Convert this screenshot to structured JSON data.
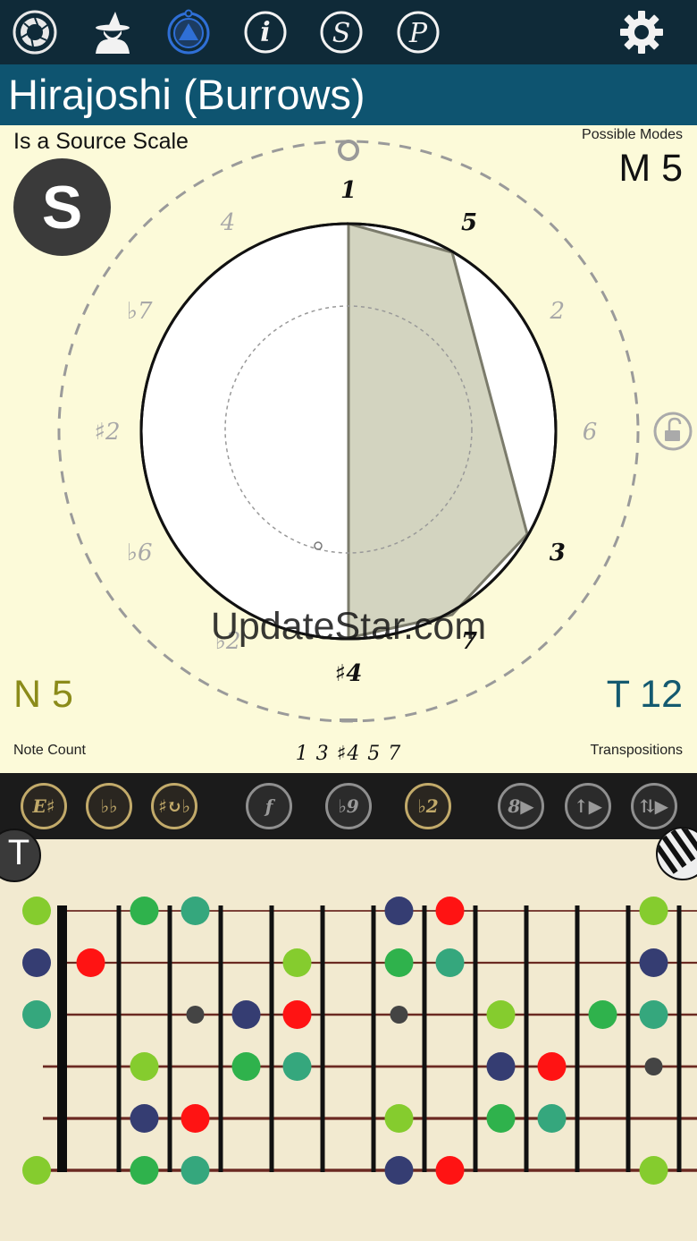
{
  "app": {
    "title": "Hirajoshi (Burrows)"
  },
  "toolbar": {
    "icons": [
      "aperture-icon",
      "wizard-icon",
      "triangle-ring-icon",
      "info-icon",
      "s-circle-icon",
      "p-circle-icon",
      "gear-icon"
    ],
    "info_glyph": "i",
    "s_glyph": "S",
    "p_glyph": "P",
    "active_color": "#2f6fd6"
  },
  "panel": {
    "source_text": "Is a Source Scale",
    "source_badge": "S",
    "modes_label": "Possible Modes",
    "modes_value": "M 5",
    "note_value": "N 5",
    "note_label": "Note Count",
    "transpositions_value": "T 12",
    "transpositions_label": "Transpositions",
    "formula": "1 3 ♯4 5 7",
    "watermark": "UpdateStar.com"
  },
  "wheel": {
    "inner_labels": [
      {
        "text": "1",
        "active": true
      },
      {
        "text": "5",
        "active": true
      },
      {
        "text": "2",
        "active": false
      },
      {
        "text": "6",
        "active": false
      },
      {
        "text": "3",
        "active": true
      },
      {
        "text": "7",
        "active": true
      },
      {
        "text": "♯4",
        "active": true
      },
      {
        "text": "♭2",
        "active": false
      },
      {
        "text": "♭6",
        "active": false
      },
      {
        "text": "♯2",
        "active": false
      },
      {
        "text": "♭7",
        "active": false
      },
      {
        "text": "4",
        "active": false
      }
    ],
    "fill_color": "#d3d4c0",
    "stroke_color": "#7b7b6b"
  },
  "midbar": {
    "buttons": [
      {
        "name": "e-sharp-button",
        "label": "E♯",
        "style": "gold"
      },
      {
        "name": "double-flat-button",
        "label": "♭♭",
        "style": "gold"
      },
      {
        "name": "cycle-accidental-button",
        "label": "♯↻♭",
        "style": "gold"
      },
      {
        "name": "f-button",
        "label": "f",
        "style": "grey"
      },
      {
        "name": "flat-nine-button",
        "label": "♭9",
        "style": "grey"
      },
      {
        "name": "flat-two-button",
        "label": "♭2",
        "style": "gold"
      },
      {
        "name": "octave-play-button",
        "label": "8▶",
        "style": "grey"
      },
      {
        "name": "up-play-button",
        "label": "↑▶",
        "style": "grey"
      },
      {
        "name": "updown-play-button",
        "label": "⇅▶",
        "style": "grey"
      }
    ]
  },
  "fretboard": {
    "t_button": "T",
    "colors": {
      "root": "#85cc2e",
      "third": "#2fb24c",
      "fifth": "#35a77d",
      "sharp4": "#353d72",
      "seventh": "#ff1313",
      "marker": "#444444"
    },
    "dots": [
      {
        "s": 0,
        "f": 0,
        "c": "root"
      },
      {
        "s": 0,
        "f": 2,
        "c": "third"
      },
      {
        "s": 0,
        "f": 3,
        "c": "fifth"
      },
      {
        "s": 0,
        "f": 7,
        "c": "sharp4"
      },
      {
        "s": 0,
        "f": 8,
        "c": "seventh"
      },
      {
        "s": 0,
        "f": 12,
        "c": "root"
      },
      {
        "s": 1,
        "f": 0,
        "c": "sharp4"
      },
      {
        "s": 1,
        "f": 1,
        "c": "seventh"
      },
      {
        "s": 1,
        "f": 5,
        "c": "root"
      },
      {
        "s": 1,
        "f": 7,
        "c": "third"
      },
      {
        "s": 1,
        "f": 8,
        "c": "fifth"
      },
      {
        "s": 1,
        "f": 12,
        "c": "sharp4"
      },
      {
        "s": 2,
        "f": 0,
        "c": "fifth"
      },
      {
        "s": 2,
        "f": 4,
        "c": "sharp4"
      },
      {
        "s": 2,
        "f": 5,
        "c": "seventh"
      },
      {
        "s": 2,
        "f": 9,
        "c": "root"
      },
      {
        "s": 2,
        "f": 11,
        "c": "third"
      },
      {
        "s": 2,
        "f": 12,
        "c": "fifth"
      },
      {
        "s": 3,
        "f": 2,
        "c": "root"
      },
      {
        "s": 3,
        "f": 4,
        "c": "third"
      },
      {
        "s": 3,
        "f": 5,
        "c": "fifth"
      },
      {
        "s": 3,
        "f": 9,
        "c": "sharp4"
      },
      {
        "s": 3,
        "f": 10,
        "c": "seventh"
      },
      {
        "s": 4,
        "f": 2,
        "c": "sharp4"
      },
      {
        "s": 4,
        "f": 3,
        "c": "seventh"
      },
      {
        "s": 4,
        "f": 7,
        "c": "root"
      },
      {
        "s": 4,
        "f": 9,
        "c": "third"
      },
      {
        "s": 4,
        "f": 10,
        "c": "fifth"
      },
      {
        "s": 5,
        "f": 0,
        "c": "root"
      },
      {
        "s": 5,
        "f": 2,
        "c": "third"
      },
      {
        "s": 5,
        "f": 3,
        "c": "fifth"
      },
      {
        "s": 5,
        "f": 7,
        "c": "sharp4"
      },
      {
        "s": 5,
        "f": 8,
        "c": "seventh"
      },
      {
        "s": 5,
        "f": 12,
        "c": "root"
      }
    ],
    "markers": [
      {
        "f": 3,
        "row": 2.5
      },
      {
        "f": 5,
        "row": 2.5
      },
      {
        "f": 7,
        "row": 2.5
      },
      {
        "f": 12,
        "row": 1.5
      },
      {
        "f": 12,
        "row": 3.5
      }
    ]
  }
}
